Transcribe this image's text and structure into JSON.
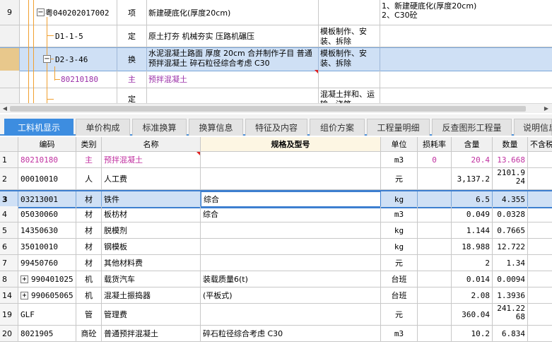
{
  "top_rows": [
    {
      "num": "9",
      "code": "粤040202017002",
      "type": "项",
      "name": "新建硬底化(厚度20cm)",
      "extra": "",
      "desc": "1、新建硬底化(厚度20cm)\n2、C30砼"
    },
    {
      "num": "",
      "code": "D1-1-5",
      "type": "定",
      "name": "原土打夯 机械夯实 压路机碾压",
      "extra": "模板制作、安装、拆除",
      "desc": ""
    },
    {
      "num": "",
      "code": "D2-3-46",
      "type": "换",
      "name": "水泥混凝土路面 厚度 20cm 合并制作子目 普通预拌混凝土 碎石粒径综合考虑 C30",
      "extra": "模板制作、安装、拆除",
      "desc": ""
    },
    {
      "num": "",
      "code": "80210180",
      "type": "主",
      "name": "预拌混凝土",
      "extra": "",
      "desc": ""
    },
    {
      "num": "",
      "code": "",
      "type": "定",
      "name": "",
      "extra": "混凝土拌和、运输、浇筑",
      "desc": ""
    }
  ],
  "tabs": [
    {
      "label": "工料机显示",
      "active": true
    },
    {
      "label": "单价构成",
      "active": false
    },
    {
      "label": "标准换算",
      "active": false
    },
    {
      "label": "换算信息",
      "active": false
    },
    {
      "label": "特征及内容",
      "active": false
    },
    {
      "label": "组价方案",
      "active": false
    },
    {
      "label": "工程量明细",
      "active": false
    },
    {
      "label": "反查图形工程量",
      "active": false
    },
    {
      "label": "说明信息",
      "active": false
    }
  ],
  "columns": {
    "code": "编码",
    "cat": "类别",
    "name": "名称",
    "spec": "规格及型号",
    "unit": "单位",
    "loss": "损耗率",
    "content": "含量",
    "qty": "数量",
    "extra": "不含税"
  },
  "rows": [
    {
      "rn": "1",
      "code": "80210180",
      "cat": "主",
      "name": "预拌混凝土",
      "spec": "",
      "unit": "m3",
      "loss": "0",
      "content": "20.4",
      "qty": "13.668",
      "plus": false,
      "pink": true
    },
    {
      "rn": "2",
      "code": "00010010",
      "cat": "人",
      "name": "人工费",
      "spec": "",
      "unit": "元",
      "loss": "",
      "content": "3,137.2",
      "qty": "2101.924",
      "plus": false,
      "pink": false
    },
    {
      "rn": "3",
      "code": "03213001",
      "cat": "材",
      "name": "铁件",
      "spec": "综合",
      "unit": "kg",
      "loss": "",
      "content": "6.5",
      "qty": "4.355",
      "plus": false,
      "pink": false
    },
    {
      "rn": "4",
      "code": "05030060",
      "cat": "材",
      "name": "板枋材",
      "spec": "综合",
      "unit": "m3",
      "loss": "",
      "content": "0.049",
      "qty": "0.0328",
      "plus": false,
      "pink": false
    },
    {
      "rn": "5",
      "code": "14350630",
      "cat": "材",
      "name": "脱模剂",
      "spec": "",
      "unit": "kg",
      "loss": "",
      "content": "1.144",
      "qty": "0.7665",
      "plus": false,
      "pink": false
    },
    {
      "rn": "6",
      "code": "35010010",
      "cat": "材",
      "name": "钢模板",
      "spec": "",
      "unit": "kg",
      "loss": "",
      "content": "18.988",
      "qty": "12.722",
      "plus": false,
      "pink": false
    },
    {
      "rn": "7",
      "code": "99450760",
      "cat": "材",
      "name": "其他材料费",
      "spec": "",
      "unit": "元",
      "loss": "",
      "content": "2",
      "qty": "1.34",
      "plus": false,
      "pink": false
    },
    {
      "rn": "8",
      "code": "990401025",
      "cat": "机",
      "name": "载货汽车",
      "spec": "装载质量6(t)",
      "unit": "台班",
      "loss": "",
      "content": "0.014",
      "qty": "0.0094",
      "plus": true,
      "pink": false
    },
    {
      "rn": "14",
      "code": "990605065",
      "cat": "机",
      "name": "混凝土振捣器",
      "spec": "(平板式)",
      "unit": "台班",
      "loss": "",
      "content": "2.08",
      "qty": "1.3936",
      "plus": true,
      "pink": false
    },
    {
      "rn": "19",
      "code": "GLF",
      "cat": "管",
      "name": "管理费",
      "spec": "",
      "unit": "元",
      "loss": "",
      "content": "360.04",
      "qty": "241.2268",
      "plus": false,
      "pink": false
    },
    {
      "rn": "20",
      "code": "8021905",
      "cat": "商砼",
      "name": "普通预拌混凝土",
      "spec": "碎石粒径综合考虑 C30",
      "unit": "m3",
      "loss": "",
      "content": "10.2",
      "qty": "6.834",
      "plus": false,
      "pink": false
    }
  ]
}
